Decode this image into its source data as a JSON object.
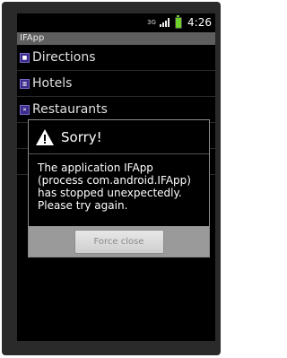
{
  "statusbar": {
    "network": "3G",
    "signal_icon": "signal-icon",
    "battery_icon": "battery-icon",
    "time": "4:26"
  },
  "app": {
    "title": "IFApp"
  },
  "list": {
    "items": [
      {
        "label": "Directions",
        "icon": "directions-icon"
      },
      {
        "label": "Hotels",
        "icon": "hotels-icon"
      },
      {
        "label": "Restaurants",
        "icon": "restaurants-icon"
      }
    ]
  },
  "dialog": {
    "title": "Sorry!",
    "message": "The application IFApp (process com.android.IFApp) has stopped unexpectedly. Please try again.",
    "button_label": "Force close",
    "icon": "warning-icon"
  },
  "colors": {
    "accent_icon": "#3b2a8a",
    "battery": "#6fd12a",
    "titlebar": "#5e5e5e",
    "dialog_footer": "#9a9a9a"
  }
}
